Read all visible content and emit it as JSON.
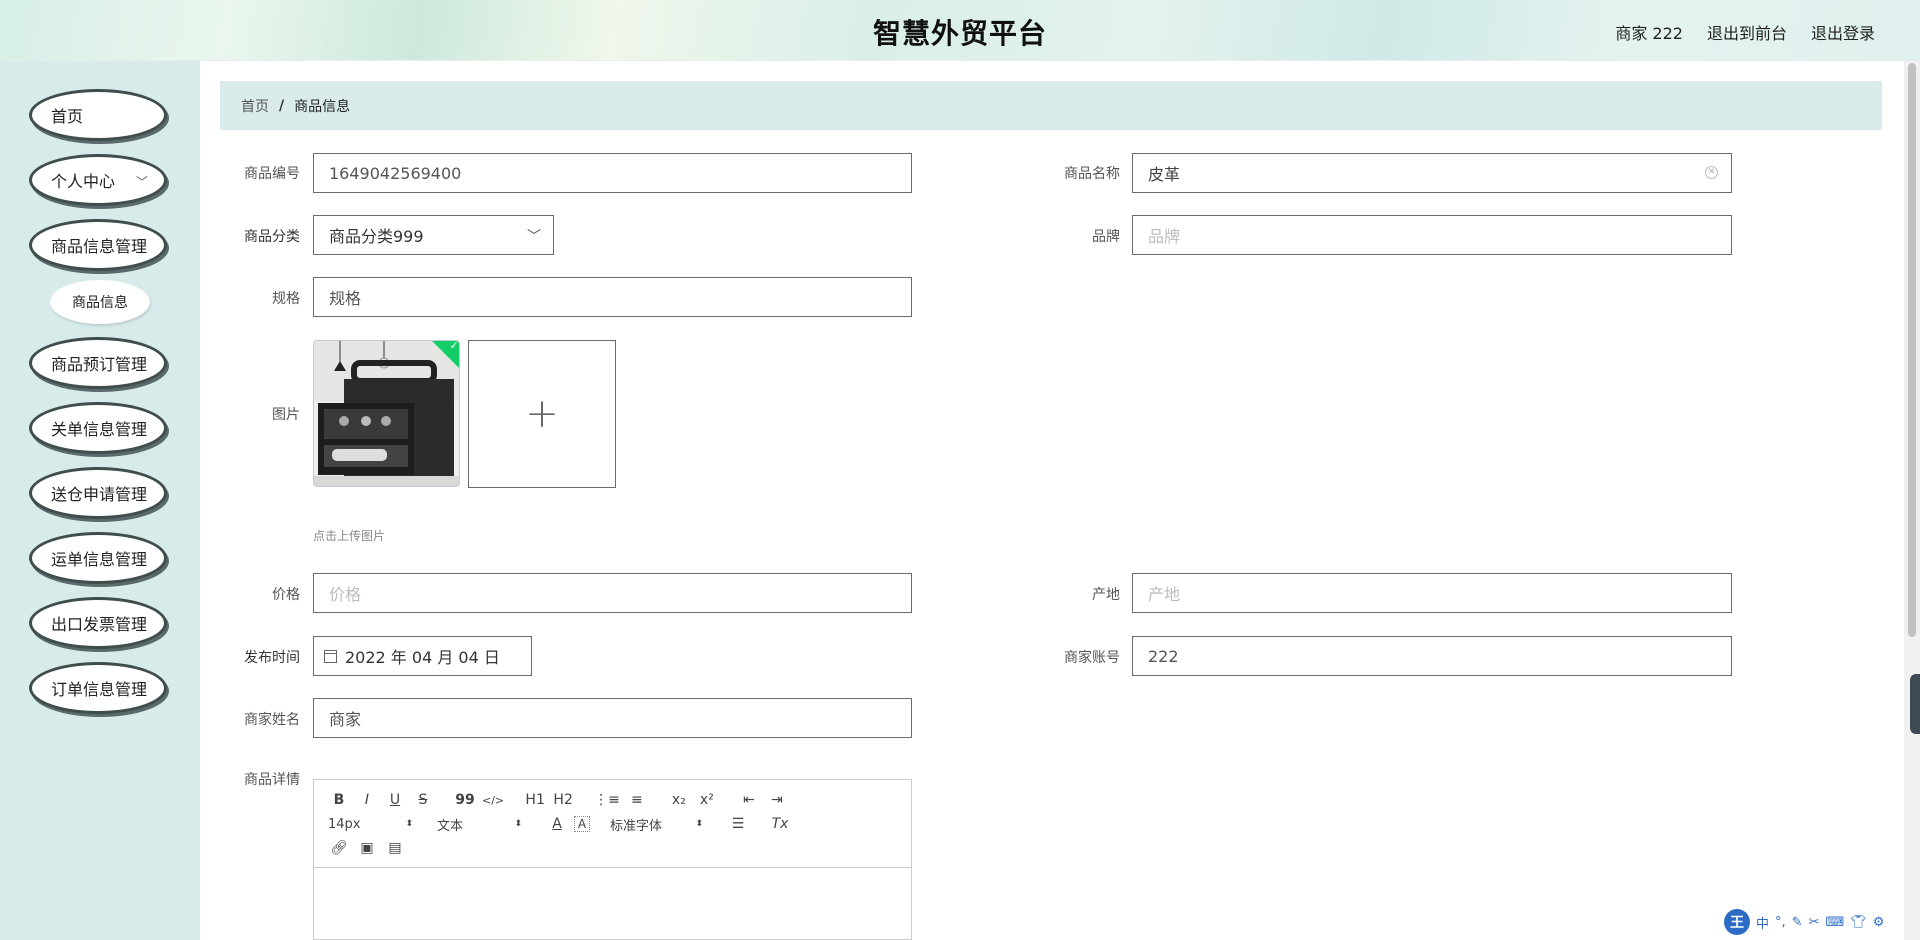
{
  "header": {
    "title": "智慧外贸平台",
    "user": "商家 222",
    "to_front": "退出到前台",
    "logout": "退出登录"
  },
  "sidebar": {
    "items": [
      {
        "label": "首页"
      },
      {
        "label": "个人中心"
      },
      {
        "label": "商品信息管理"
      },
      {
        "label": "商品预订管理"
      },
      {
        "label": "关单信息管理"
      },
      {
        "label": "送仓申请管理"
      },
      {
        "label": "运单信息管理"
      },
      {
        "label": "出口发票管理"
      },
      {
        "label": "订单信息管理"
      }
    ],
    "sub_item": "商品信息"
  },
  "breadcrumb": {
    "home": "首页",
    "separator": "/",
    "current": "商品信息"
  },
  "form": {
    "code_label": "商品编号",
    "code_value": "1649042569400",
    "name_label": "商品名称",
    "name_value": "皮革",
    "category_label": "商品分类",
    "category_value": "商品分类999",
    "brand_label": "品牌",
    "brand_placeholder": "品牌",
    "spec_label": "规格",
    "spec_placeholder": "规格",
    "image_label": "图片",
    "upload_tip": "点击上传图片",
    "price_label": "价格",
    "price_placeholder": "价格",
    "origin_label": "产地",
    "origin_placeholder": "产地",
    "publish_label": "发布时间",
    "publish_value": "2022 年 04 月 04 日",
    "merchant_account_label": "商家账号",
    "merchant_account_value": "222",
    "merchant_name_label": "商家姓名",
    "merchant_name_value": "商家",
    "detail_label": "商品详情"
  },
  "editor": {
    "font_size": "14px",
    "paragraph": "文本",
    "font_family": "标准字体",
    "h1": "H1",
    "h2": "H2",
    "bold": "B",
    "italic": "I",
    "underline": "U",
    "strike": "S",
    "quote": "99",
    "code": "</>",
    "sub": "x₂",
    "sup": "x²",
    "text_color": "A",
    "clear": "Tx"
  },
  "ime": {
    "logo": "王",
    "mode": "中",
    "punct": "°,"
  },
  "colors": {
    "sidebar_bg": "#d7ebea",
    "breadcrumb_bg": "#d9ebeb",
    "menu_border": "#3f4d4d",
    "success_badge": "#13ce66"
  }
}
